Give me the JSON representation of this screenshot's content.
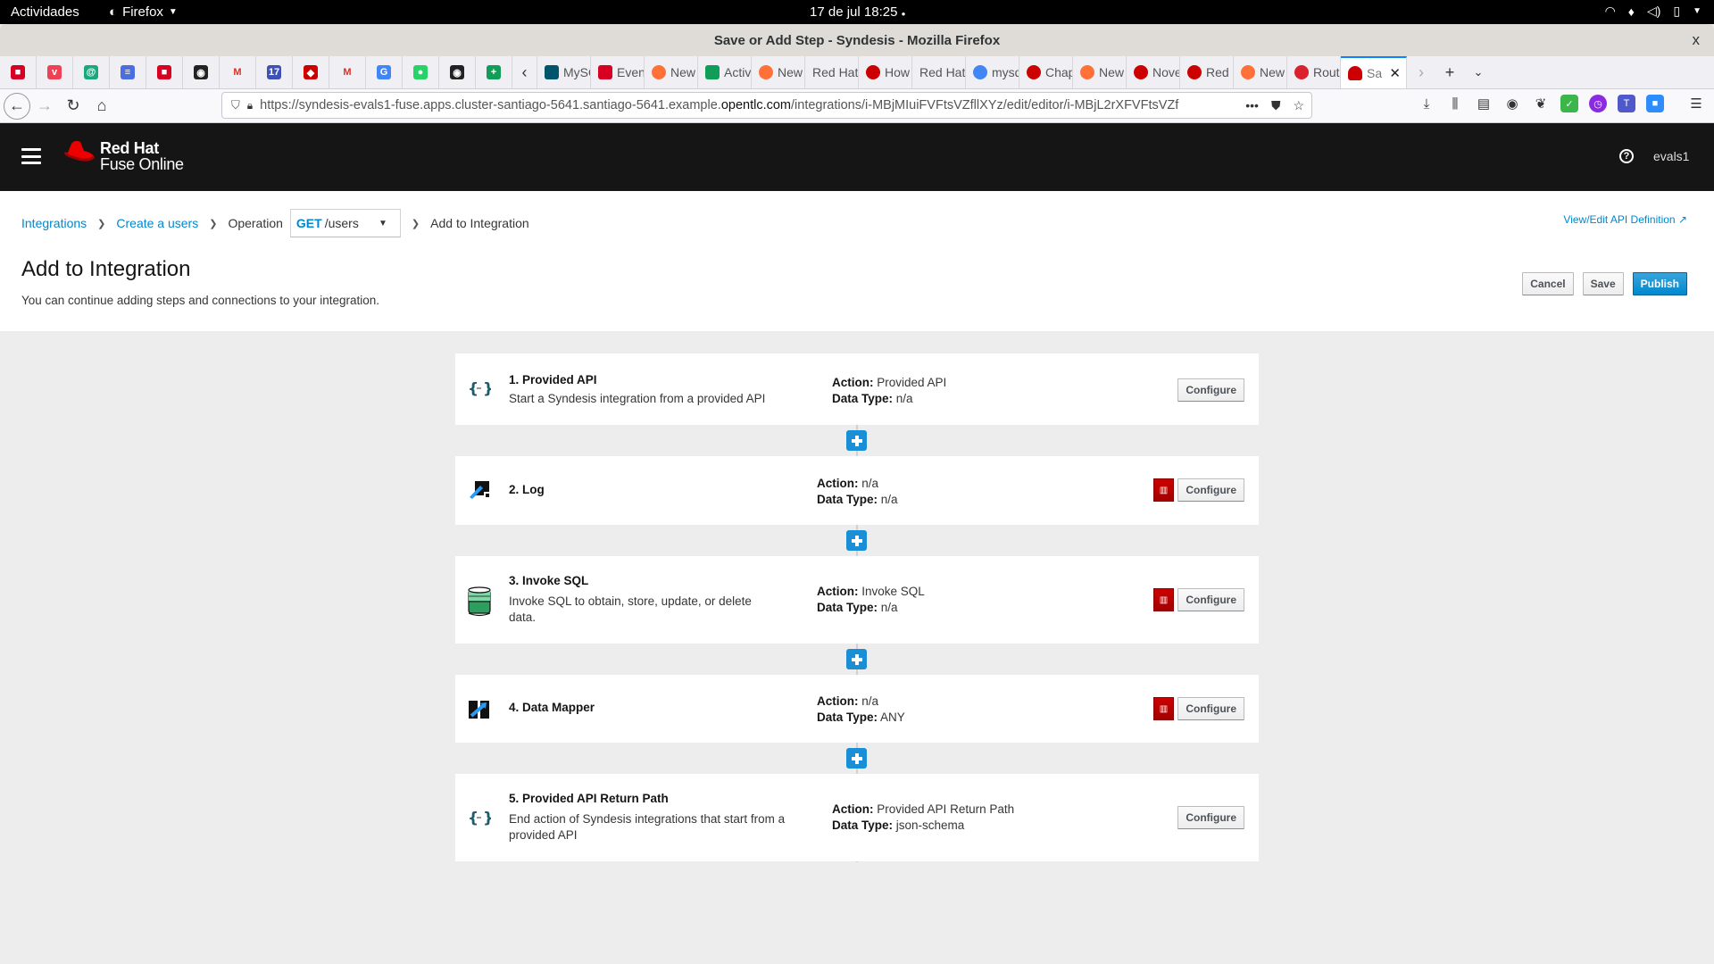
{
  "system": {
    "activities": "Actividades",
    "app_menu": "Firefox",
    "clock": "17 de jul  18:25",
    "tray_icons": [
      "wifi-icon",
      "microphone-icon",
      "volume-icon",
      "battery-icon",
      "system-menu-chevron-icon"
    ]
  },
  "window": {
    "title": "Save or Add Step - Syndesis - Mozilla Firefox",
    "close_label": "x"
  },
  "browser": {
    "pinned_tabs": [
      {
        "icon": "red-note-icon",
        "color": "#d70022",
        "glyph": "■"
      },
      {
        "icon": "pocket-icon",
        "color": "#ef4056",
        "glyph": "v"
      },
      {
        "icon": "at-icon",
        "color": "#1aa87e",
        "glyph": "@"
      },
      {
        "icon": "docs-icon",
        "color": "#4a6ee0",
        "glyph": "≡"
      },
      {
        "icon": "red-note-icon",
        "color": "#d70022",
        "glyph": "■"
      },
      {
        "icon": "github-icon",
        "color": "#222222",
        "glyph": "◉"
      },
      {
        "icon": "gmail-icon",
        "color": "#ffffff",
        "glyph": "M"
      },
      {
        "icon": "calendar-icon",
        "color": "#3f51b5",
        "glyph": "17"
      },
      {
        "icon": "redhat-icon",
        "color": "#cc0000",
        "glyph": "◆"
      },
      {
        "icon": "gmail-icon",
        "color": "#ffffff",
        "glyph": "M"
      },
      {
        "icon": "translate-icon",
        "color": "#4285f4",
        "glyph": "G"
      },
      {
        "icon": "whatsapp-icon",
        "color": "#25d366",
        "glyph": "●"
      },
      {
        "icon": "github-icon",
        "color": "#222222",
        "glyph": "◉"
      },
      {
        "icon": "sheets-icon",
        "color": "#0f9d58",
        "glyph": "+"
      }
    ],
    "tabs": [
      {
        "label": "MySQL",
        "icon": "mysql-icon",
        "color": "#00546b"
      },
      {
        "label": "Event",
        "icon": "event-icon",
        "color": "#d70022"
      },
      {
        "label": "New",
        "icon": "firefox-icon",
        "color": "#ff7139"
      },
      {
        "label": "Activ",
        "icon": "sheets-icon",
        "color": "#0f9d58"
      },
      {
        "label": "New",
        "icon": "firefox-icon",
        "color": "#ff7139"
      },
      {
        "label": "Red Hat",
        "icon": "",
        "color": ""
      },
      {
        "label": "How",
        "icon": "redhat-icon",
        "color": "#cc0000"
      },
      {
        "label": "Red Hat",
        "icon": "",
        "color": ""
      },
      {
        "label": "mysq",
        "icon": "google-icon",
        "color": "#4285f4"
      },
      {
        "label": "Chap",
        "icon": "redhat-icon",
        "color": "#cc0000"
      },
      {
        "label": "New",
        "icon": "firefox-icon",
        "color": "#ff7139"
      },
      {
        "label": "Nove",
        "icon": "redhat-icon",
        "color": "#cc0000"
      },
      {
        "label": "Red H",
        "icon": "redhat-icon",
        "color": "#cc0000"
      },
      {
        "label": "New",
        "icon": "firefox-icon",
        "color": "#ff7139"
      },
      {
        "label": "Route",
        "icon": "openshift-icon",
        "color": "#db212e"
      }
    ],
    "active_tab": {
      "label": "Sa",
      "icon": "redhat-icon",
      "color": "#cc0000",
      "close": "✕"
    },
    "url_prefix": "https://syndesis-evals1-fuse.apps.cluster-santiago-5641.santiago-5641.example.",
    "url_domain": "opentlc.com",
    "url_suffix": "/integrations/i-MBjMIuiFVFtsVZfllXYz/edit/editor/i-MBjL2rXFVFtsVZf"
  },
  "app": {
    "brand_line1": "Red Hat",
    "brand_line2": "Fuse Online",
    "help": "?",
    "user": "evals1"
  },
  "breadcrumb": {
    "items": [
      "Integrations",
      "Create a users"
    ],
    "operation_label": "Operation",
    "operation_method": "GET",
    "operation_path": "/users",
    "current": "Add to Integration",
    "api_definition_link": "View/Edit API Definition"
  },
  "page": {
    "title": "Add to Integration",
    "subtitle": "You can continue adding steps and connections to your integration.",
    "cancel": "Cancel",
    "save": "Save",
    "publish": "Publish"
  },
  "steps": [
    {
      "title": "1. Provided API",
      "description": "Start a Syndesis integration from a provided API",
      "action_label": "Action:",
      "action": "Provided API",
      "data_type_label": "Data Type:",
      "data_type": "n/a",
      "deletable": false,
      "configure": "Configure",
      "icon": "api-icon"
    },
    {
      "title": "2. Log",
      "description": "",
      "action_label": "Action:",
      "action": "n/a",
      "data_type_label": "Data Type:",
      "data_type": "n/a",
      "deletable": true,
      "configure": "Configure",
      "icon": "log-icon"
    },
    {
      "title": "3. Invoke SQL",
      "description": "Invoke SQL to obtain, store, update, or delete data.",
      "action_label": "Action:",
      "action": "Invoke SQL",
      "data_type_label": "Data Type:",
      "data_type": "n/a",
      "deletable": true,
      "configure": "Configure",
      "icon": "database-icon"
    },
    {
      "title": "4. Data Mapper",
      "description": "",
      "action_label": "Action:",
      "action": "n/a",
      "data_type_label": "Data Type:",
      "data_type": "ANY",
      "deletable": true,
      "configure": "Configure",
      "icon": "data-mapper-icon"
    },
    {
      "title": "5. Provided API Return Path",
      "description": "End action of Syndesis integrations that start from a provided API",
      "action_label": "Action:",
      "action": "Provided API Return Path",
      "data_type_label": "Data Type:",
      "data_type": "json-schema",
      "deletable": false,
      "configure": "Configure",
      "icon": "api-icon"
    }
  ],
  "colors": {
    "link": "#0088ce",
    "primary": "#0088ce",
    "danger": "#cc0000",
    "add_step": "#1a8fd6",
    "header_bg": "#151515"
  }
}
